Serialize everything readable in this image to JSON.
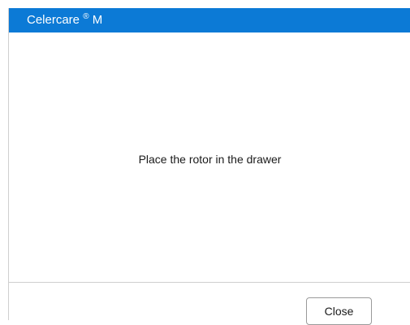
{
  "dialog": {
    "title": {
      "brand": "Celercare",
      "mark": "®",
      "model": "M"
    },
    "message": "Place the rotor in the drawer",
    "close_label": "Close"
  },
  "colors": {
    "title_bar": "#0c7ad6",
    "title_text": "#ffffff",
    "body_text": "#1a1a1a"
  }
}
